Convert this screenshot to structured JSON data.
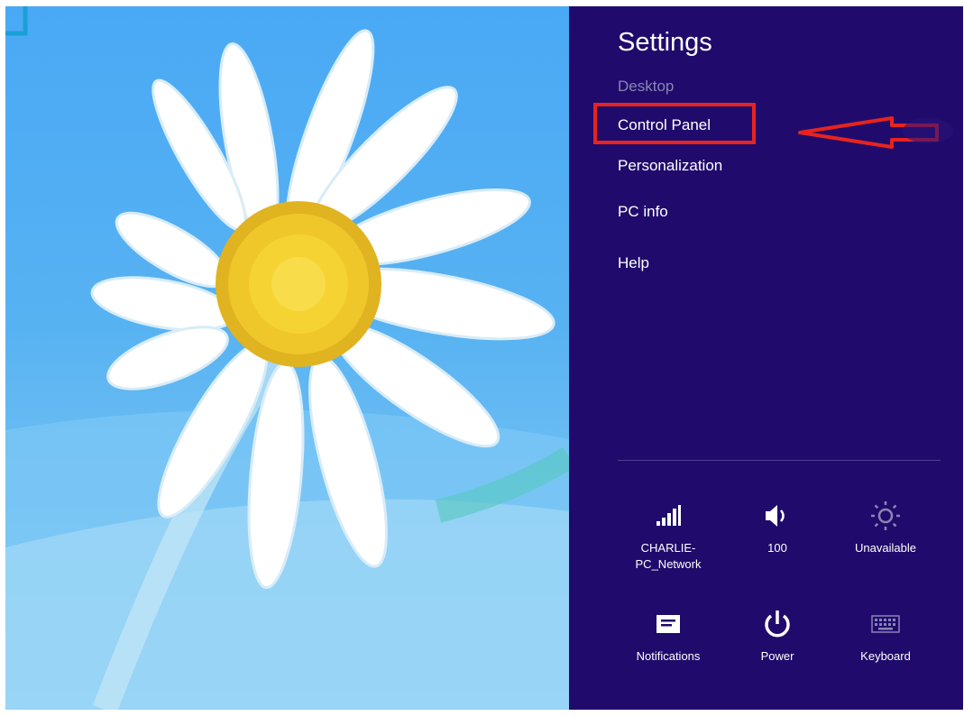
{
  "charm_bar": {
    "title": "Settings",
    "menu": [
      {
        "label": "Desktop",
        "enabled": false
      },
      {
        "label": "Control Panel",
        "enabled": true,
        "highlighted": true
      },
      {
        "label": "Personalization",
        "enabled": true
      },
      {
        "label": "PC info",
        "enabled": true
      },
      {
        "label": "Help",
        "enabled": true
      }
    ],
    "quick_settings": [
      {
        "label": "CHARLIE-\nPC_Network",
        "icon": "network-signal-icon"
      },
      {
        "label": "100",
        "icon": "volume-icon"
      },
      {
        "label": "Unavailable",
        "icon": "brightness-icon"
      },
      {
        "label": "Notifications",
        "icon": "notifications-icon"
      },
      {
        "label": "Power",
        "icon": "power-icon"
      },
      {
        "label": "Keyboard",
        "icon": "keyboard-icon"
      }
    ]
  },
  "colors": {
    "charm_background": "#200b6c",
    "highlight": "#e8231e",
    "wallpaper_sky": "#4aa9f5"
  }
}
